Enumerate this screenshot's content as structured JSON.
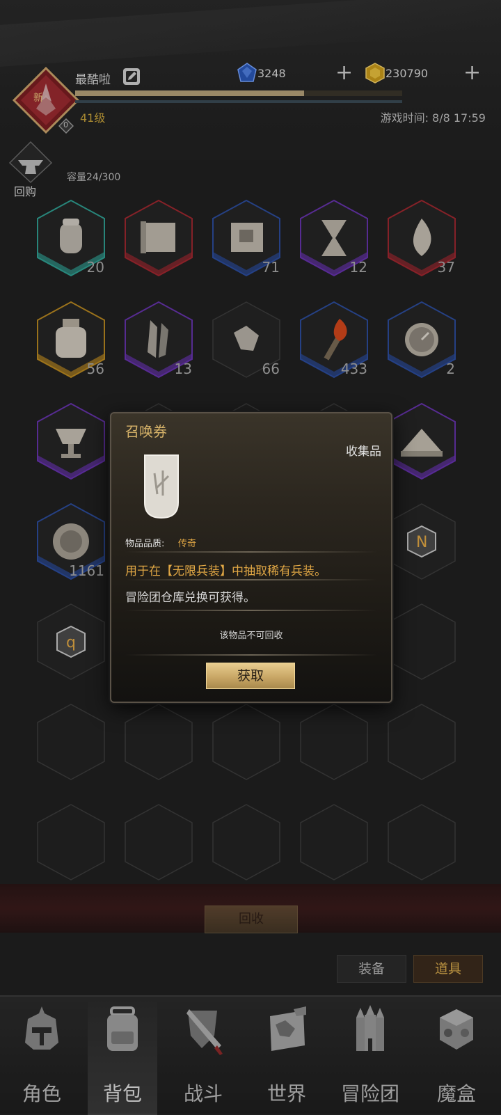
{
  "header": {
    "avatar_badge": "新",
    "player_name": "最酷啦",
    "level": "41级",
    "badge_count": "0",
    "exp_fraction": 0.7,
    "currency_blue": "3248",
    "currency_gold": "230790",
    "game_time": "游戏时间: 8/8 17:59"
  },
  "inventory": {
    "recycle_shop_label": "回购",
    "capacity": "容量24/300",
    "items": [
      {
        "icon": "salt-jar-icon",
        "count": "20",
        "frame": "teal"
      },
      {
        "icon": "scroll-map-icon",
        "count": "",
        "frame": "red"
      },
      {
        "icon": "scroll-blueprint-icon",
        "count": "71",
        "frame": "blue"
      },
      {
        "icon": "hourglass-icon",
        "count": "12",
        "frame": "purple"
      },
      {
        "icon": "flame-icon",
        "count": "37",
        "frame": "red"
      },
      {
        "icon": "bottle-icon",
        "count": "56",
        "frame": "gold"
      },
      {
        "icon": "crystal-icon",
        "count": "13",
        "frame": "purple"
      },
      {
        "icon": "ore-chunk-icon",
        "count": "66",
        "frame": "none"
      },
      {
        "icon": "torch-icon",
        "count": "433",
        "frame": "blue"
      },
      {
        "icon": "compass-icon",
        "count": "2",
        "frame": "blue"
      },
      {
        "icon": "chalice-icon",
        "count": "",
        "frame": "purple"
      },
      {
        "icon": "sand-pile-icon",
        "count": "",
        "frame": "purple"
      },
      {
        "icon": "medallion-icon",
        "count": "1161",
        "frame": "blue"
      },
      {
        "icon": "rune-n-icon",
        "count": "",
        "frame": "none"
      },
      {
        "icon": "rune-q-icon",
        "count": "",
        "frame": "none"
      }
    ],
    "recycle_button": "回收",
    "tab_equip": "装备",
    "tab_items": "道具"
  },
  "item_popup": {
    "title": "召唤券",
    "category": "收集品",
    "quality_label": "物品品质:",
    "quality_value": "传奇",
    "description": "用于在【无限兵装】中抽取稀有兵装。",
    "source": "冒险团仓库兑换可获得。",
    "recycle_note": "该物品不可回收",
    "obtain_button": "获取"
  },
  "nav": [
    {
      "label": "角色",
      "icon": "helmet-icon"
    },
    {
      "label": "背包",
      "icon": "backpack-icon",
      "active": true
    },
    {
      "label": "战斗",
      "icon": "sword-shield-icon"
    },
    {
      "label": "世界",
      "icon": "world-map-icon"
    },
    {
      "label": "冒险团",
      "icon": "castle-icon"
    },
    {
      "label": "魔盒",
      "icon": "magic-box-icon"
    }
  ],
  "colors": {
    "accent_gold": "#d8b46a",
    "legendary": "#e2a845",
    "frame_red": "#a8262f",
    "frame_blue": "#2b4fa6",
    "frame_purple": "#6b33b8",
    "frame_teal": "#2fa89a",
    "frame_gold": "#c48f1e"
  }
}
